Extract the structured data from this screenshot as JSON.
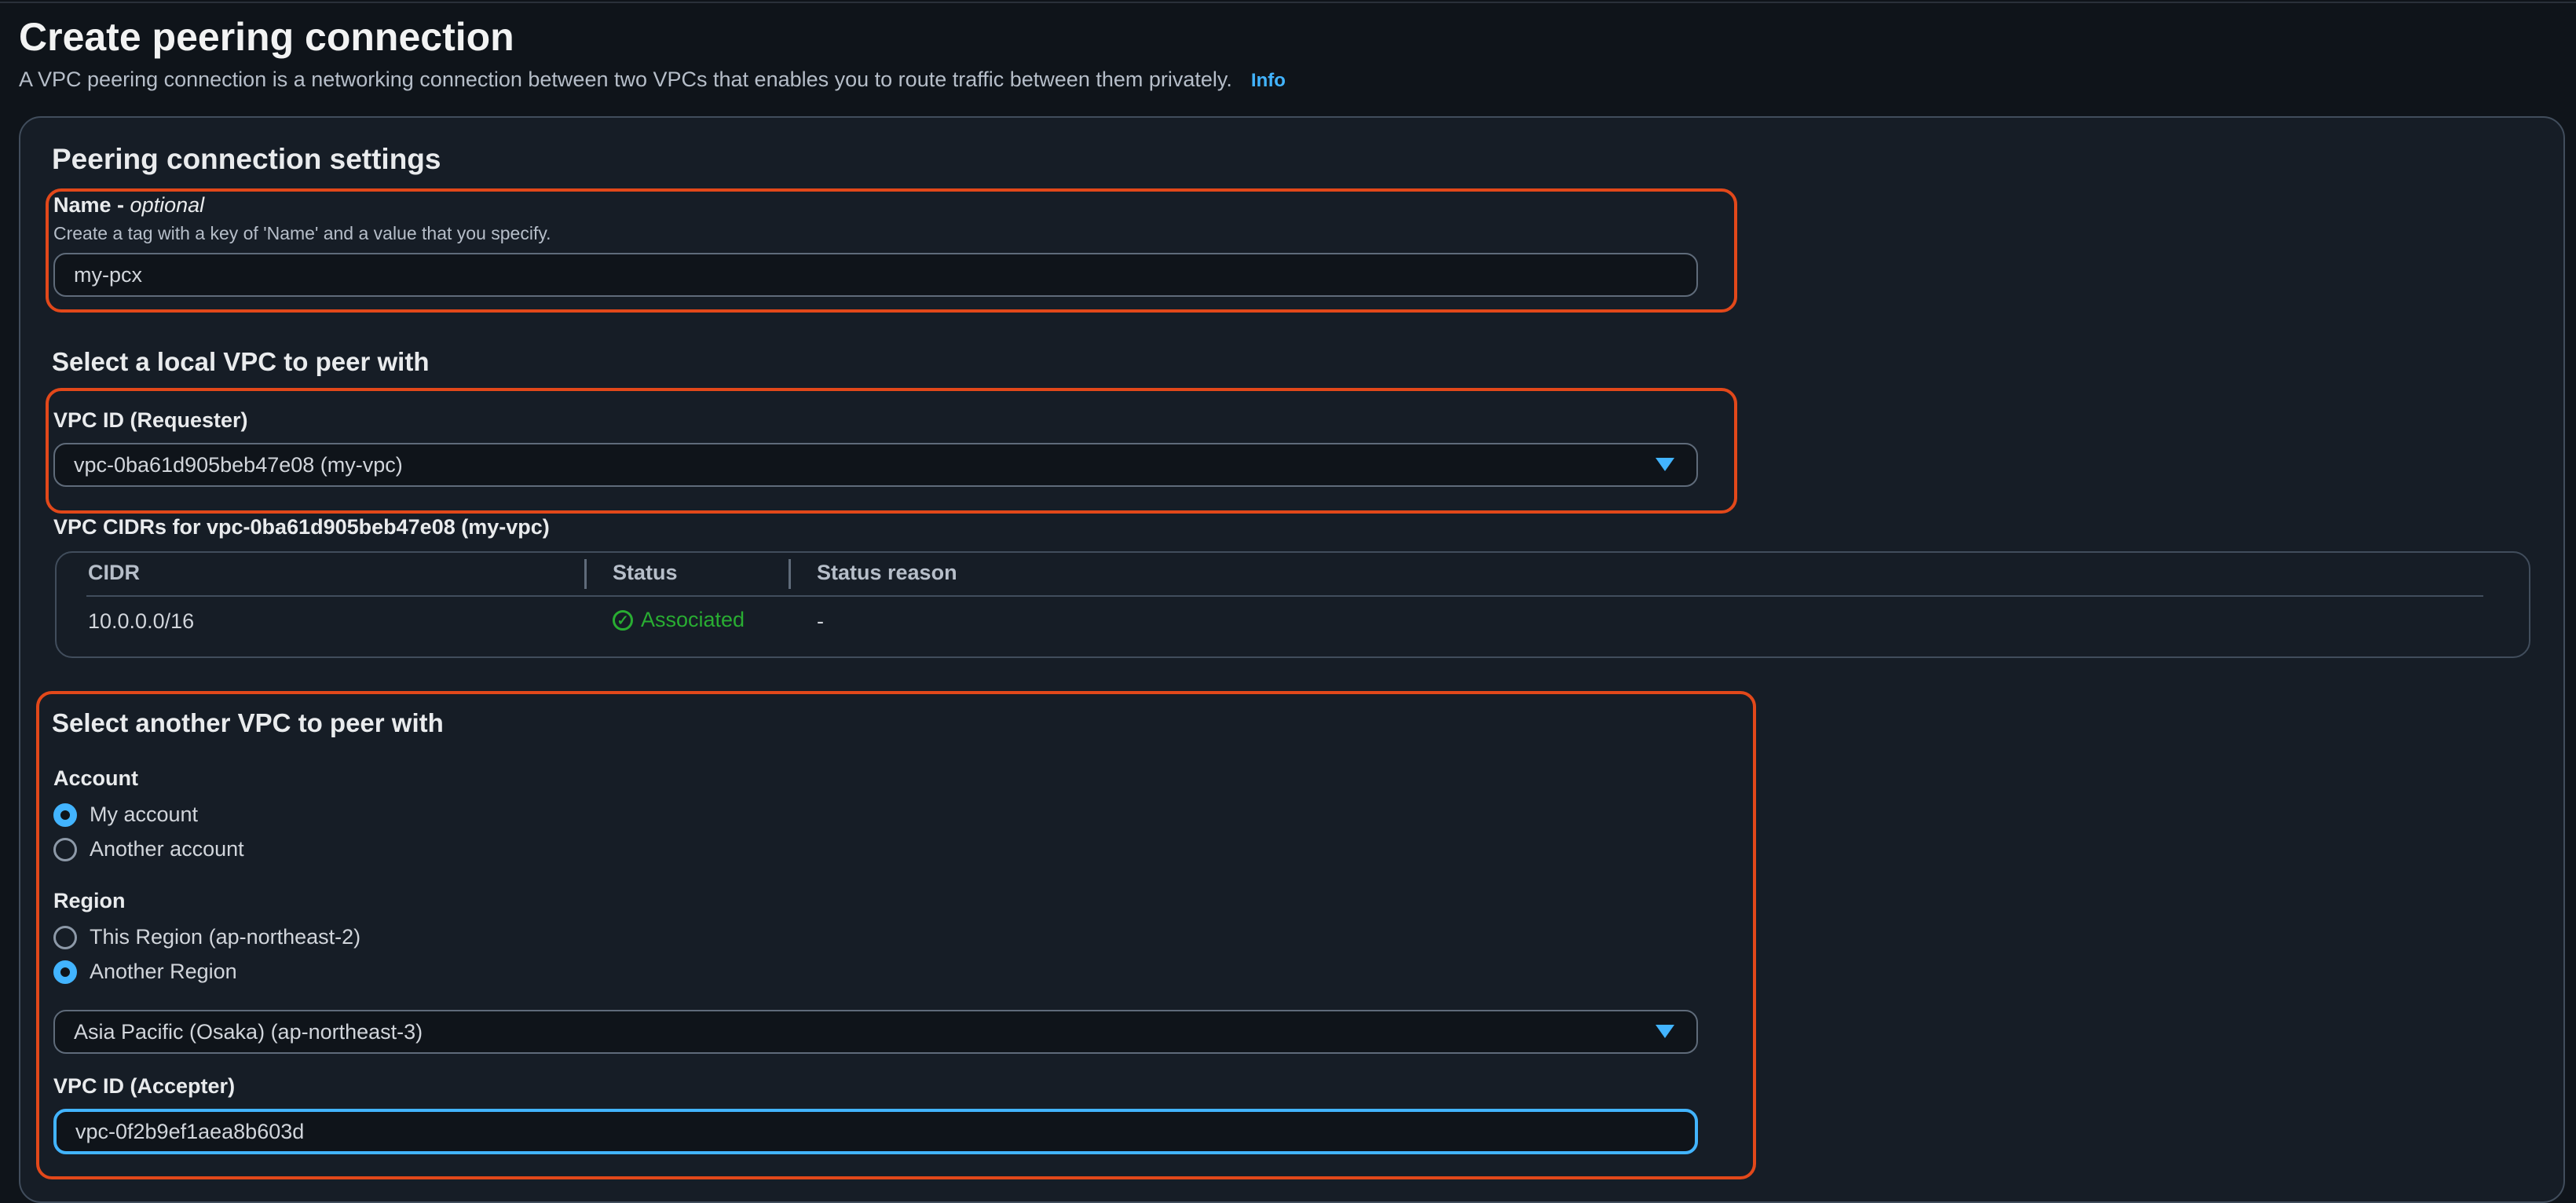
{
  "header": {
    "title": "Create peering connection",
    "description": "A VPC peering connection is a networking connection between two VPCs that enables you to route traffic between them privately.",
    "info_link": "Info"
  },
  "settings": {
    "title": "Peering connection settings",
    "name_label": "Name -",
    "name_optional": "optional",
    "name_hint": "Create a tag with a key of 'Name' and a value that you specify.",
    "name_value": "my-pcx"
  },
  "local_vpc": {
    "title": "Select a local VPC to peer with",
    "vpc_id_label": "VPC ID (Requester)",
    "vpc_id_value": "vpc-0ba61d905beb47e08 (my-vpc)",
    "cidrs_title": "VPC CIDRs for vpc-0ba61d905beb47e08 (my-vpc)",
    "table": {
      "headers": [
        "CIDR",
        "Status",
        "Status reason"
      ],
      "rows": [
        {
          "cidr": "10.0.0.0/16",
          "status": "Associated",
          "reason": "-"
        }
      ]
    }
  },
  "another_vpc": {
    "title": "Select another VPC to peer with",
    "account_label": "Account",
    "account_options": [
      "My account",
      "Another account"
    ],
    "account_selected": "My account",
    "region_label": "Region",
    "region_options": [
      "This Region (ap-northeast-2)",
      "Another Region"
    ],
    "region_selected": "Another Region",
    "region_select_value": "Asia Pacific (Osaka) (ap-northeast-3)",
    "accepter_label": "VPC ID (Accepter)",
    "accepter_value": "vpc-0f2b9ef1aea8b603d"
  },
  "colors": {
    "background": "#0f141a",
    "panel": "#161d26",
    "accent": "#42b4ff",
    "highlight": "#e2481a",
    "success": "#29ad32"
  }
}
